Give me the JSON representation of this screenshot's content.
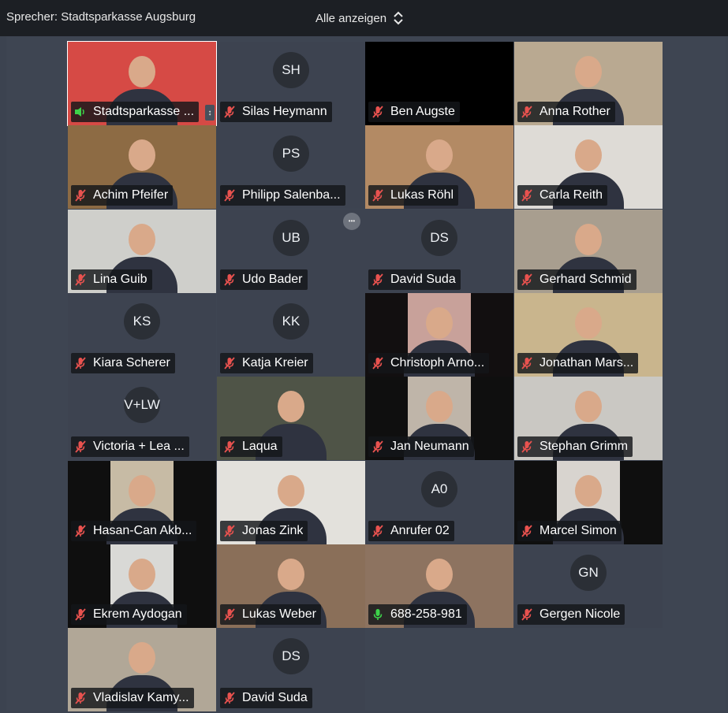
{
  "topbar": {
    "speaker_label": "Sprecher: Stadtsparkasse Augsburg",
    "view_label": "Alle anzeigen",
    "view_icon": "chevron-up-down-icon"
  },
  "colors": {
    "muted_red": "#e8524f",
    "mic_green": "#3dd34a",
    "tile_bg": "#3d4350",
    "bar_bg": "#1c1f24"
  },
  "participants": [
    {
      "name": "Stadtsparkasse ...",
      "mic": "active",
      "video": true,
      "bg": "#d64a45",
      "active": true
    },
    {
      "name": "Silas Heymann",
      "mic": "muted",
      "initials": "SH"
    },
    {
      "name": "Ben Augste",
      "mic": "muted",
      "black": true
    },
    {
      "name": "Anna Rother",
      "mic": "muted",
      "video": true,
      "bg": "#b9a991"
    },
    {
      "name": "Achim Pfeifer",
      "mic": "muted",
      "video": true,
      "bg": "#8d6b44"
    },
    {
      "name": "Philipp Salenba...",
      "mic": "muted",
      "initials": "PS"
    },
    {
      "name": "Lukas Röhl",
      "mic": "muted",
      "video": true,
      "bg": "#b38a64"
    },
    {
      "name": "Carla Reith",
      "mic": "muted",
      "video": true,
      "bg": "#dedbd6"
    },
    {
      "name": "Lina Guib",
      "mic": "muted",
      "video": true,
      "bg": "#cfcfcb"
    },
    {
      "name": "Udo Bader",
      "mic": "muted",
      "initials": "UB",
      "more": true
    },
    {
      "name": "David Suda",
      "mic": "muted",
      "initials": "DS"
    },
    {
      "name": "Gerhard Schmid",
      "mic": "muted",
      "video": true,
      "bg": "#a89e8f"
    },
    {
      "name": "Kiara Scherer",
      "mic": "muted",
      "initials": "KS"
    },
    {
      "name": "Katja Kreier",
      "mic": "muted",
      "initials": "KK"
    },
    {
      "name": "Christoph Arno...",
      "mic": "muted",
      "video": true,
      "bg": "#120f10",
      "inner": "#c8a19a"
    },
    {
      "name": "Jonathan Mars...",
      "mic": "muted",
      "video": true,
      "bg": "#c9b58d"
    },
    {
      "name": "Victoria + Lea ...",
      "mic": "muted",
      "initials": "V+LW"
    },
    {
      "name": "Laqua",
      "mic": "muted",
      "video": true,
      "bg": "#4f5447"
    },
    {
      "name": "Jan Neumann",
      "mic": "muted",
      "video": true,
      "bg": "#0f0f0f",
      "inner": "#bfb5a9"
    },
    {
      "name": "Stephan Grimm",
      "mic": "muted",
      "video": true,
      "bg": "#cac8c3"
    },
    {
      "name": "Hasan-Can Akb...",
      "mic": "muted",
      "video": true,
      "bg": "#0f0f0f",
      "inner": "#c7bba5"
    },
    {
      "name": "Jonas Zink",
      "mic": "muted",
      "video": true,
      "bg": "#e3e1dc"
    },
    {
      "name": "Anrufer 02",
      "mic": "muted",
      "initials": "A0"
    },
    {
      "name": "Marcel Simon",
      "mic": "muted",
      "video": true,
      "bg": "#0f0f0f",
      "inner": "#d8d4cf"
    },
    {
      "name": "Ekrem Aydogan",
      "mic": "muted",
      "video": true,
      "bg": "#0f0f0f",
      "inner": "#d9d9d6"
    },
    {
      "name": "Lukas Weber",
      "mic": "muted",
      "video": true,
      "bg": "#8a6f59"
    },
    {
      "name": "688-258-981",
      "mic": "on",
      "video": true,
      "bg": "#8d7360"
    },
    {
      "name": "Gergen Nicole",
      "mic": "muted",
      "initials": "GN"
    },
    {
      "name": "Vladislav Kamy...",
      "mic": "muted",
      "video": true,
      "bg": "#b1a797"
    },
    {
      "name": "David Suda",
      "mic": "muted",
      "initials": "DS"
    }
  ]
}
